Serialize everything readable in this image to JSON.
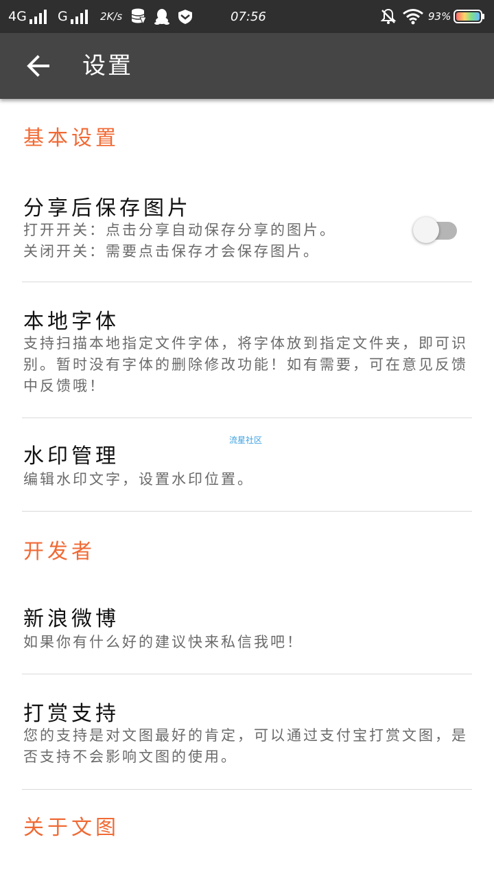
{
  "status_bar": {
    "network_4g": "4G",
    "network_g": "G",
    "speed": "2K/s",
    "time": "07:56",
    "battery_percent": "93%",
    "icons": [
      "signal-4g-icon",
      "signal-g-icon",
      "database-icon",
      "qq-icon",
      "vpn-icon",
      "notifications-off-icon",
      "wifi-icon",
      "battery-icon"
    ]
  },
  "app_bar": {
    "title": "设置",
    "back_icon": "arrow-left-icon"
  },
  "sections": {
    "basic": {
      "title": "基本设置"
    },
    "developer": {
      "title": "开发者"
    },
    "about": {
      "title": "关于文图"
    }
  },
  "items": {
    "save_after_share": {
      "title": "分享后保存图片",
      "desc_line1": "打开开关：点击分享自动保存分享的图片。",
      "desc_line2": "关闭开关：需要点击保存才会保存图片。",
      "toggle_on": false
    },
    "local_font": {
      "title": "本地字体",
      "desc_line1": "支持扫描本地指定文件字体，将字体放到指定文件夹，即可识",
      "desc_line2": "别。暂时没有字体的删除修改功能！如有需要，可在意见反馈",
      "desc_line3": "中反馈哦！"
    },
    "watermark": {
      "title": "水印管理",
      "desc": "编辑水印文字，设置水印位置。",
      "overlay_text": "流星社区"
    },
    "weibo": {
      "title": "新浪微博",
      "desc": "如果你有什么好的建议快来私信我吧！"
    },
    "donate": {
      "title": "打赏支持",
      "desc_line1": "您的支持是对文图最好的肯定，可以通过支付宝打赏文图，是",
      "desc_line2": "否支持不会影响文图的使用。"
    }
  },
  "colors": {
    "status_bar": "#2f2f2f",
    "app_bar": "#454545",
    "section_accent": "#f06a35",
    "title_text": "#111111",
    "desc_text": "#6a6a6a",
    "divider": "#d9d9d9"
  }
}
